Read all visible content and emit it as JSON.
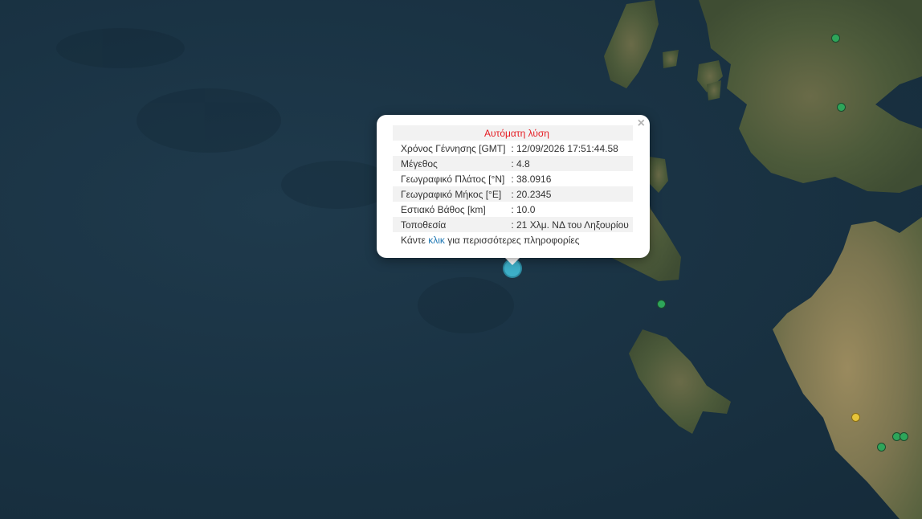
{
  "popup": {
    "title": "Αυτόματη λύση",
    "rows": [
      {
        "label": "Χρόνος Γέννησης [GMT]",
        "value": ": 12/09/2026 17:51:44.58"
      },
      {
        "label": "Μέγεθος",
        "value": ": 4.8"
      },
      {
        "label": "Γεωγραφικό Πλάτος [°N]",
        "value": ": 38.0916"
      },
      {
        "label": "Γεωγραφικό Μήκος [°E]",
        "value": ": 20.2345"
      },
      {
        "label": "Εστιακό Βάθος [km]",
        "value": ": 10.0"
      },
      {
        "label": "Τοποθεσία",
        "value": ": 21 Χλμ. ΝΔ του Ληξουρίου"
      }
    ],
    "more_prefix": "Κάντε ",
    "more_link": "κλικ",
    "more_suffix": " για περισσότερες πληροφορίες",
    "close_icon": "×"
  },
  "colors": {
    "sea": "#1a3344",
    "land": "#4f5a3c",
    "selected_marker": "#3fb6cf",
    "green_marker": "#2ea55a",
    "yellow_marker": "#e6c43a",
    "title_red": "#e51c23",
    "link_blue": "#1f78b4"
  }
}
